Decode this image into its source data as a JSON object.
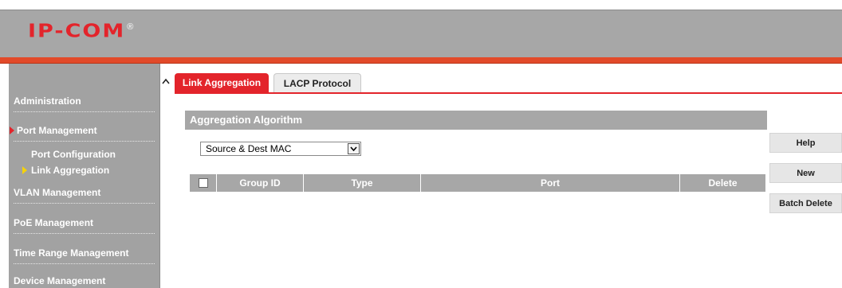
{
  "brand": {
    "logo_text": "IP-COM",
    "logo_mark": "®"
  },
  "sidebar": {
    "items": [
      {
        "label": "Administration",
        "state": "collapsed"
      },
      {
        "label": "Port Management",
        "state": "expanded"
      },
      {
        "label": "Port Configuration",
        "state": "sub"
      },
      {
        "label": "Link Aggregation",
        "state": "sub-selected"
      },
      {
        "label": "VLAN Management",
        "state": "collapsed"
      },
      {
        "label": "PoE Management",
        "state": "collapsed"
      },
      {
        "label": "Time Range Management",
        "state": "collapsed"
      },
      {
        "label": "Device Management",
        "state": "collapsed"
      }
    ]
  },
  "scroll": {
    "up_icon": "chevron-up-icon",
    "glyph": "^"
  },
  "tabs": [
    {
      "label": "Link Aggregation",
      "active": true
    },
    {
      "label": "LACP Protocol",
      "active": false
    }
  ],
  "section": {
    "title": "Aggregation Algorithm"
  },
  "algorithm_select": {
    "value": "Source & Dest MAC"
  },
  "table": {
    "columns": [
      "Group ID",
      "Type",
      "Port",
      "Delete"
    ],
    "rows": []
  },
  "actions": {
    "help": "Help",
    "new": "New",
    "batch_delete": "Batch Delete"
  },
  "colors": {
    "accent_red": "#e3242b",
    "header_gray": "#a7a7a7",
    "bar_orange": "#e24a2a",
    "indicator_yellow": "#f5d20a"
  }
}
